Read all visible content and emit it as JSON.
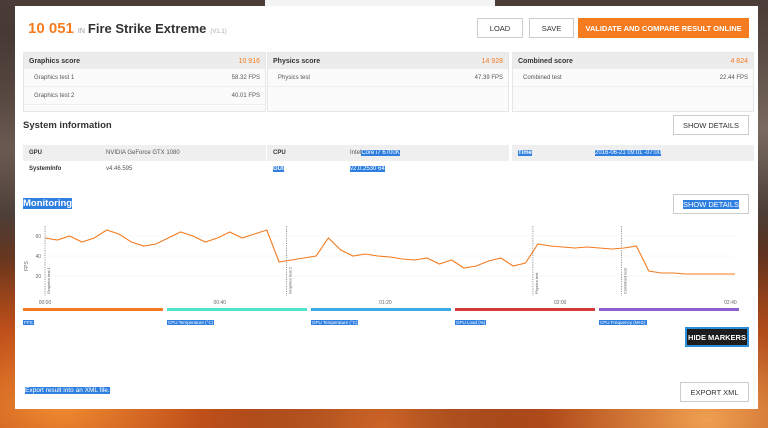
{
  "header": {
    "score": "10 051",
    "in_text": "IN",
    "test_name": "Fire Strike Extreme",
    "version": "(V1.1)",
    "load_label": "LOAD",
    "save_label": "SAVE",
    "validate_label": "VALIDATE AND COMPARE RESULT ONLINE"
  },
  "scores": {
    "graphics": {
      "label": "Graphics score",
      "value": "10 916",
      "rows": [
        {
          "name": "Graphics test 1",
          "value": "58.32 FPS"
        },
        {
          "name": "Graphics test 2",
          "value": "40.01 FPS"
        }
      ]
    },
    "physics": {
      "label": "Physics score",
      "value": "14 928",
      "rows": [
        {
          "name": "Physics test",
          "value": "47.39 FPS"
        }
      ]
    },
    "combined": {
      "label": "Combined score",
      "value": "4 824",
      "rows": [
        {
          "name": "Combined test",
          "value": "22.44 FPS"
        }
      ]
    }
  },
  "system": {
    "title": "System information",
    "show_details": "SHOW DETAILS",
    "gpu_key": "GPU",
    "gpu_val": "NVIDIA GeForce GTX 1080",
    "sysinfo_key": "SystemInfo",
    "sysinfo_val": "v4.46.595",
    "cpu_key": "CPU",
    "cpu_val_prefix": "Intel ",
    "cpu_val_hl": "Core i7 6700K",
    "gui_key": "GUI",
    "gui_val": "v2.0.2530 64",
    "time_key": "Time",
    "time_val": "2016-06-21 09:01 -07:00"
  },
  "monitoring": {
    "title": "Monitoring",
    "show_details": "SHOW DETAILS",
    "hide_markers": "HIDE MARKERS",
    "y_axis_label": "FPS",
    "y_ticks": [
      "60",
      "40",
      "20"
    ],
    "x_ticks": [
      "00:00",
      "00:40",
      "01:20",
      "02:00",
      "02:40"
    ],
    "markers": [
      "Graphics test 1",
      "Graphics test 2",
      "Physics test",
      "Combined test"
    ],
    "legend": [
      {
        "label": "FPS",
        "color": "#f47b20"
      },
      {
        "label": "CPU Temperature (°C)",
        "color": "#4fe3c7"
      },
      {
        "label": "GPU Temperature (°C)",
        "color": "#3aa9e6"
      },
      {
        "label": "GPU Load (%)",
        "color": "#d63a3a"
      },
      {
        "label": "CPU Frequency (MHz)",
        "color": "#8d5fd0"
      }
    ]
  },
  "chart_data": {
    "type": "line",
    "ylabel": "FPS",
    "xlabel": "",
    "ylim": [
      0,
      70
    ],
    "series": [
      {
        "name": "FPS",
        "color": "#f47b20",
        "x": [
          0,
          5,
          10,
          15,
          20,
          25,
          30,
          35,
          40,
          45,
          50,
          55,
          60,
          65,
          70,
          75,
          80,
          85,
          90,
          95,
          100,
          105,
          110,
          115,
          120,
          125,
          130,
          135,
          140,
          145,
          150,
          155,
          160,
          165,
          170,
          175,
          180,
          185,
          190,
          195,
          200,
          205,
          210,
          215,
          220,
          225,
          230,
          235,
          240,
          245,
          250,
          255,
          260,
          265,
          270,
          275,
          280
        ],
        "y": [
          58,
          56,
          60,
          54,
          58,
          66,
          62,
          54,
          50,
          52,
          58,
          64,
          60,
          54,
          58,
          64,
          58,
          62,
          66,
          34,
          36,
          38,
          40,
          58,
          46,
          40,
          42,
          40,
          39,
          37,
          36,
          38,
          32,
          36,
          28,
          30,
          35,
          38,
          30,
          33,
          52,
          50,
          49,
          48,
          49,
          48,
          47,
          48,
          50,
          25,
          23,
          23,
          22,
          22,
          22,
          22,
          22
        ]
      }
    ]
  }
}
